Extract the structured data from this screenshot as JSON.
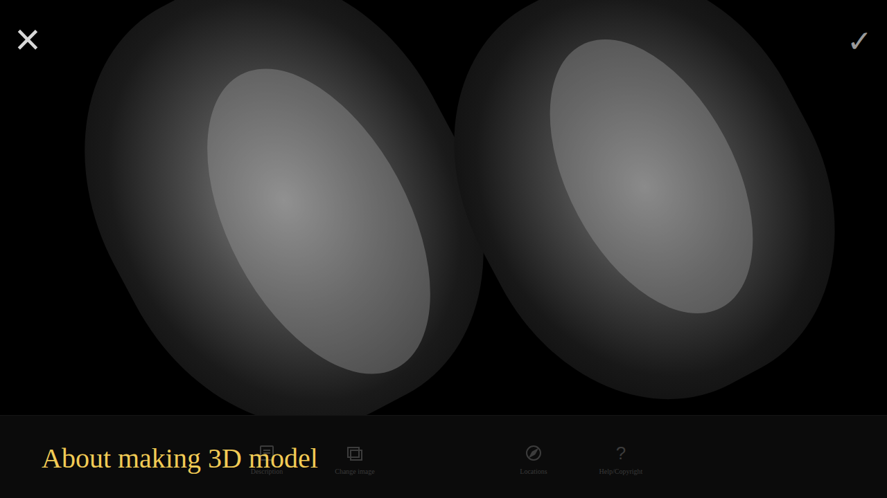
{
  "viewer": {
    "close_icon": "×",
    "confirm_icon": "✓"
  },
  "toolbar": [
    {
      "kind": "description",
      "label": "Description"
    },
    {
      "kind": "image",
      "label": "Change image"
    },
    {
      "kind": "compass",
      "label": "Locations"
    },
    {
      "kind": "glyph",
      "glyph": "?",
      "label": "Help/Copyright"
    }
  ],
  "caption": "About making 3D model"
}
